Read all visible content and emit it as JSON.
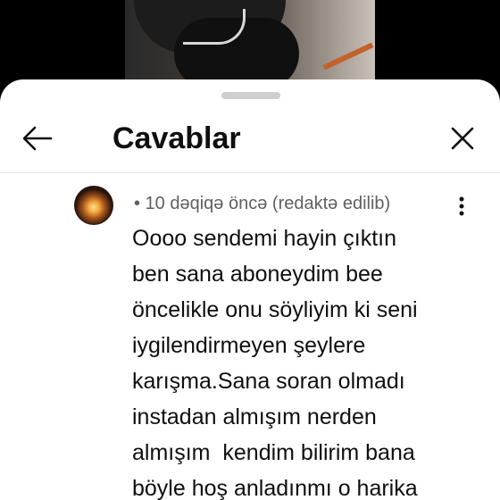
{
  "header": {
    "title": "Cavablar"
  },
  "icons": {
    "back": "arrow-left-icon",
    "close": "close-icon",
    "more": "more-vert-icon"
  },
  "comment": {
    "meta": "• 10 dəqiqə öncə (redaktə edilib)",
    "lines": [
      "Oooo sendemi hayin çıktın",
      "ben sana aboneydim bee",
      "öncelikle onu söyliyim ki seni",
      "iygilendirmeyen şeylere",
      "karışma.Sana soran olmadı",
      "instadan almışım nerden",
      "almışım  kendim bilirim bana",
      "böyle hoş anladınmı o harika"
    ]
  },
  "colors": {
    "sheet_background": "#ffffff",
    "title_text": "#0f0f0f",
    "meta_text": "#606060",
    "handle": "#cfcfcf"
  }
}
